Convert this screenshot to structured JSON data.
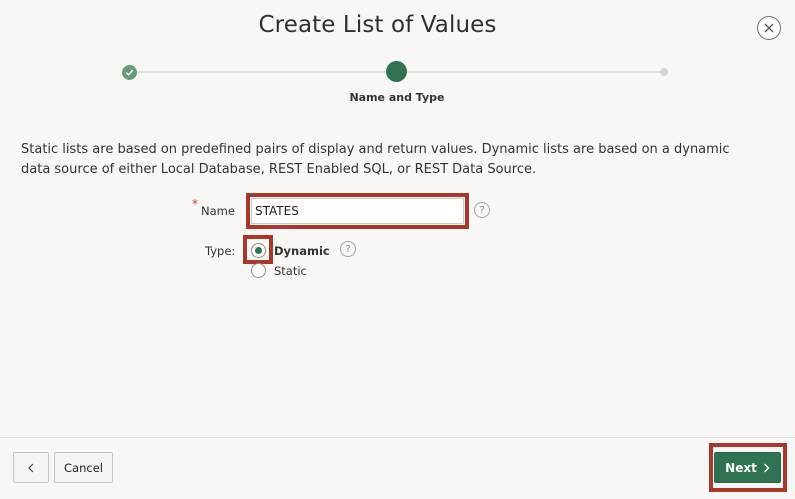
{
  "dialog": {
    "title": "Create List of Values",
    "close_icon": "close-icon"
  },
  "wizard": {
    "steps": [
      {
        "state": "completed",
        "icon": "check-icon"
      },
      {
        "state": "current",
        "label": "Name and Type"
      },
      {
        "state": "upcoming"
      }
    ]
  },
  "intro_text": "Static lists are based on predefined pairs of display and return values. Dynamic lists are based on a dynamic data source of either Local Database, REST Enabled SQL, or REST Data Source.",
  "form": {
    "name": {
      "required_marker": "*",
      "label": "Name",
      "value": "STATES",
      "help_icon": "?"
    },
    "type": {
      "label": "Type:",
      "help_icon": "?",
      "options": [
        {
          "label": "Dynamic",
          "checked": true
        },
        {
          "label": "Static",
          "checked": false
        }
      ]
    }
  },
  "footer": {
    "previous_icon": "chevron-left-icon",
    "cancel_label": "Cancel",
    "next_label": "Next",
    "next_icon": "chevron-right-icon"
  },
  "colors": {
    "accent": "#2f7353",
    "highlight": "#a7382b",
    "required": "#c74634"
  }
}
